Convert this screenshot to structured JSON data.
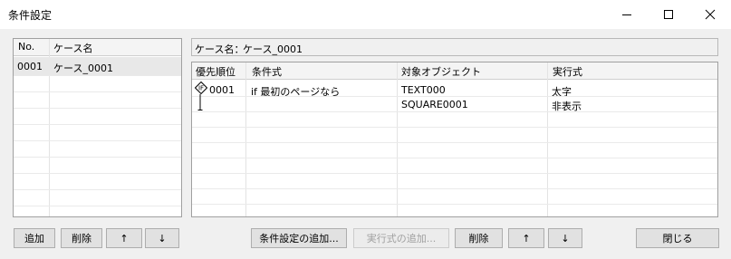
{
  "window": {
    "title": "条件設定",
    "minimize_icon": "minimize-icon",
    "maximize_icon": "maximize-icon",
    "close_icon": "close-icon"
  },
  "case_list": {
    "columns": [
      "No.",
      "ケース名"
    ],
    "rows": [
      {
        "no": "0001",
        "name": "ケース_0001",
        "selected": true
      }
    ]
  },
  "case_name_label": "ケース名：",
  "case_name_value": "ケース_0001",
  "condition_table": {
    "columns": [
      "優先順位",
      "条件式",
      "対象オブジェクト",
      "実行式"
    ],
    "rows": [
      {
        "priority": "0001",
        "priority_icon": "condition-diamond-icon",
        "condition": "if 最初のページなら",
        "target": "TEXT000",
        "action": "太字"
      },
      {
        "priority": "",
        "priority_icon": "branch-line-icon",
        "condition": "",
        "target": "SQUARE0001",
        "action": "非表示"
      }
    ]
  },
  "left_buttons": {
    "add": "追加",
    "delete": "削除",
    "up": "↑",
    "down": "↓"
  },
  "right_buttons": {
    "add_condition": "条件設定の追加...",
    "add_action": "実行式の追加...",
    "delete": "削除",
    "up": "↑",
    "down": "↓"
  },
  "close_button": "閉じる"
}
